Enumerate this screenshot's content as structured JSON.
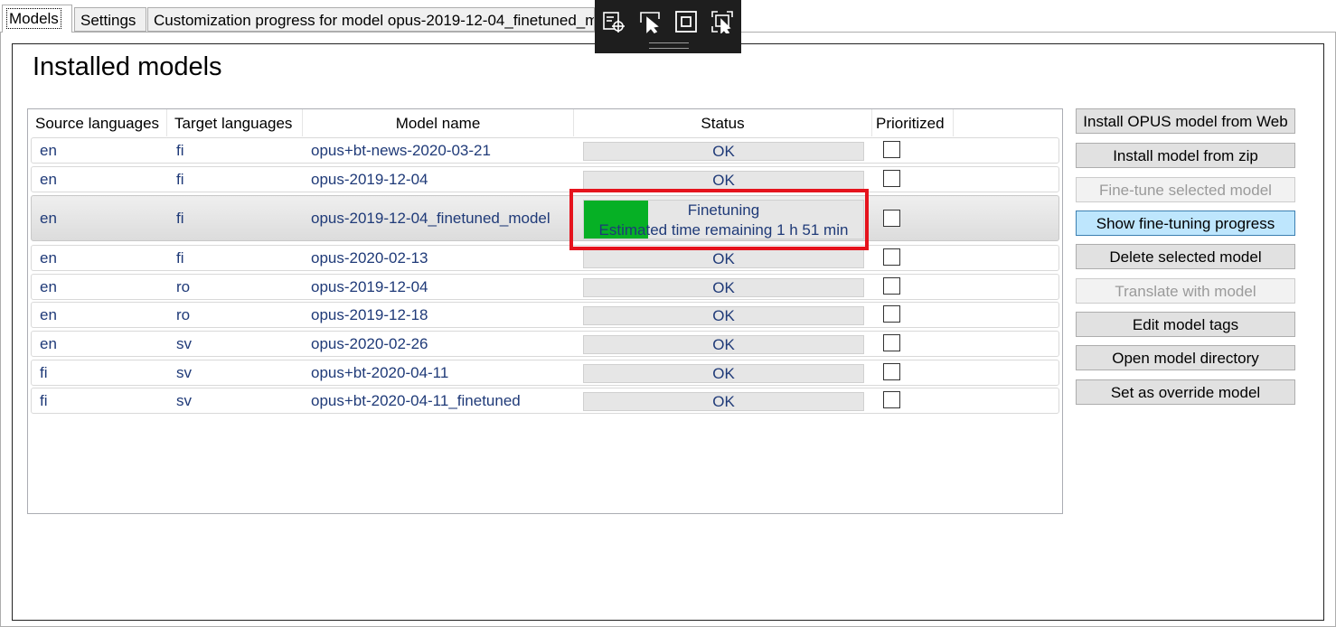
{
  "tabs": {
    "models": "Models",
    "settings": "Settings",
    "customization": "Customization progress for model opus-2019-12-04_finetuned_model"
  },
  "page_title": "Installed models",
  "columns": {
    "source": "Source languages",
    "target": "Target languages",
    "model": "Model name",
    "status": "Status",
    "prioritized": "Prioritized"
  },
  "rows": [
    {
      "source": "en",
      "target": "fi",
      "model": "opus+bt-news-2020-03-21",
      "status": "OK"
    },
    {
      "source": "en",
      "target": "fi",
      "model": "opus-2019-12-04",
      "status": "OK"
    },
    {
      "source": "en",
      "target": "fi",
      "model": "opus-2019-12-04_finetuned_model",
      "status": "Finetuning",
      "status_detail": "Estimated time remaining 1 h 51 min",
      "progress": 0.23
    },
    {
      "source": "en",
      "target": "fi",
      "model": "opus-2020-02-13",
      "status": "OK"
    },
    {
      "source": "en",
      "target": "ro",
      "model": "opus-2019-12-04",
      "status": "OK"
    },
    {
      "source": "en",
      "target": "ro",
      "model": "opus-2019-12-18",
      "status": "OK"
    },
    {
      "source": "en",
      "target": "sv",
      "model": "opus-2020-02-26",
      "status": "OK"
    },
    {
      "source": "fi",
      "target": "sv",
      "model": "opus+bt-2020-04-11",
      "status": "OK"
    },
    {
      "source": "fi",
      "target": "sv",
      "model": "opus+bt-2020-04-11_finetuned",
      "status": "OK"
    }
  ],
  "buttons": {
    "install_web": "Install OPUS model from Web",
    "install_zip": "Install model from zip",
    "fine_tune": "Fine-tune selected model",
    "show_progress": "Show fine-tuning progress",
    "delete": "Delete selected model",
    "translate": "Translate with model",
    "edit_tags": "Edit model tags",
    "open_dir": "Open model directory",
    "set_override": "Set as override model"
  },
  "toolbar_icons": [
    "select-element-icon",
    "pointer-icon",
    "frame-icon",
    "track-focus-icon"
  ],
  "colors": {
    "progress_fill": "#06b025",
    "highlight": "#e5131d",
    "selected_button": "#bee6fd",
    "cell_text": "#1f3a78"
  }
}
